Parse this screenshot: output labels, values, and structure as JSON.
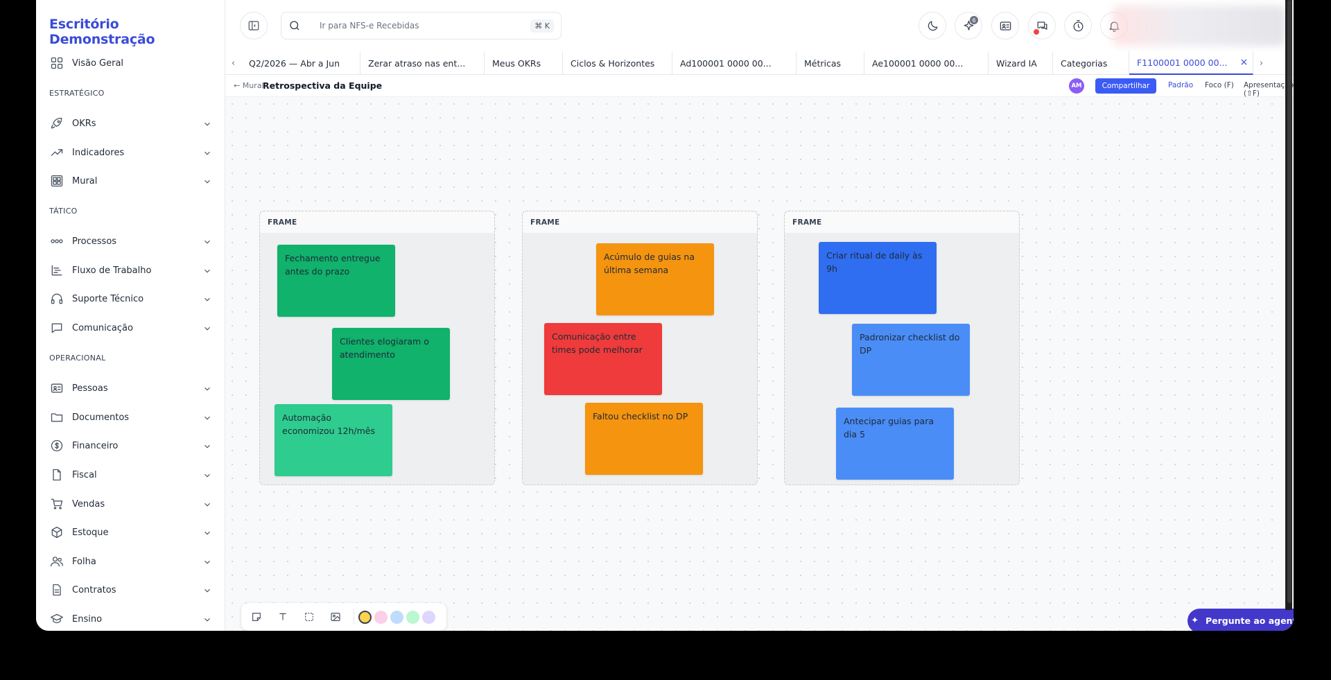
{
  "brand": "Escritório Demonstração",
  "sidebar": {
    "overview": "Visão Geral",
    "sections": [
      "ESTRATÉGICO",
      "TÁTICO",
      "OPERACIONAL"
    ],
    "items": [
      {
        "label": "OKRs"
      },
      {
        "label": "Indicadores"
      },
      {
        "label": "Mural"
      },
      {
        "label": "Processos"
      },
      {
        "label": "Fluxo de Trabalho"
      },
      {
        "label": "Suporte Técnico"
      },
      {
        "label": "Comunicação"
      },
      {
        "label": "Pessoas"
      },
      {
        "label": "Documentos"
      },
      {
        "label": "Financeiro"
      },
      {
        "label": "Fiscal"
      },
      {
        "label": "Vendas"
      },
      {
        "label": "Estoque"
      },
      {
        "label": "Folha"
      },
      {
        "label": "Contratos"
      },
      {
        "label": "Ensino"
      }
    ]
  },
  "search": {
    "placeholder": "Ir para NFS-e Recebidas",
    "shortcut": "⌘ K"
  },
  "topbar": {
    "ai_badge": "6"
  },
  "tabs": [
    {
      "label": "Q2/2026 — Abr a Jun"
    },
    {
      "label": "Zerar atraso nas ent..."
    },
    {
      "label": "Meus OKRs"
    },
    {
      "label": "Ciclos & Horizontes"
    },
    {
      "label": "Ad100001 0000 00..."
    },
    {
      "label": "Métricas"
    },
    {
      "label": "Ae100001 0000 00..."
    },
    {
      "label": "Wizard IA"
    },
    {
      "label": "Categorias"
    },
    {
      "label": "F1100001 0000 00..."
    }
  ],
  "board": {
    "back": "← Mural",
    "title": "Retrospectiva da Equipe",
    "avatar": "AM",
    "share": "Compartilhar",
    "modes": [
      "Padrão",
      "Foco (F)",
      "Apresentação (⇧F)"
    ]
  },
  "frames": [
    {
      "title": "FRAME",
      "notes": [
        {
          "text": "Fechamento entregue antes do prazo",
          "color": "#10b26c"
        },
        {
          "text": "Clientes elogiaram o atendimento",
          "color": "#10b26c"
        },
        {
          "text": "Automação economizou 12h/mês",
          "color": "#2ecc8e"
        }
      ]
    },
    {
      "title": "FRAME",
      "notes": [
        {
          "text": "Acúmulo de guias na última semana",
          "color": "#f5940f"
        },
        {
          "text": "Comunicação entre times pode melhorar",
          "color": "#ef3b3b"
        },
        {
          "text": "Faltou checklist no DP",
          "color": "#f5940f"
        }
      ]
    },
    {
      "title": "FRAME",
      "notes": [
        {
          "text": "Criar ritual de daily às 9h",
          "color": "#2f6ef0"
        },
        {
          "text": "Padronizar checklist do DP",
          "color": "#4a8df6"
        },
        {
          "text": "Antecipar guias para dia 5",
          "color": "#4a8df6"
        }
      ]
    }
  ],
  "palette": [
    "#fcd34d",
    "#fbcfe8",
    "#bfdbfe",
    "#bbf7d0",
    "#ddd6fe"
  ],
  "ask_agent": "Pergunte ao agente"
}
